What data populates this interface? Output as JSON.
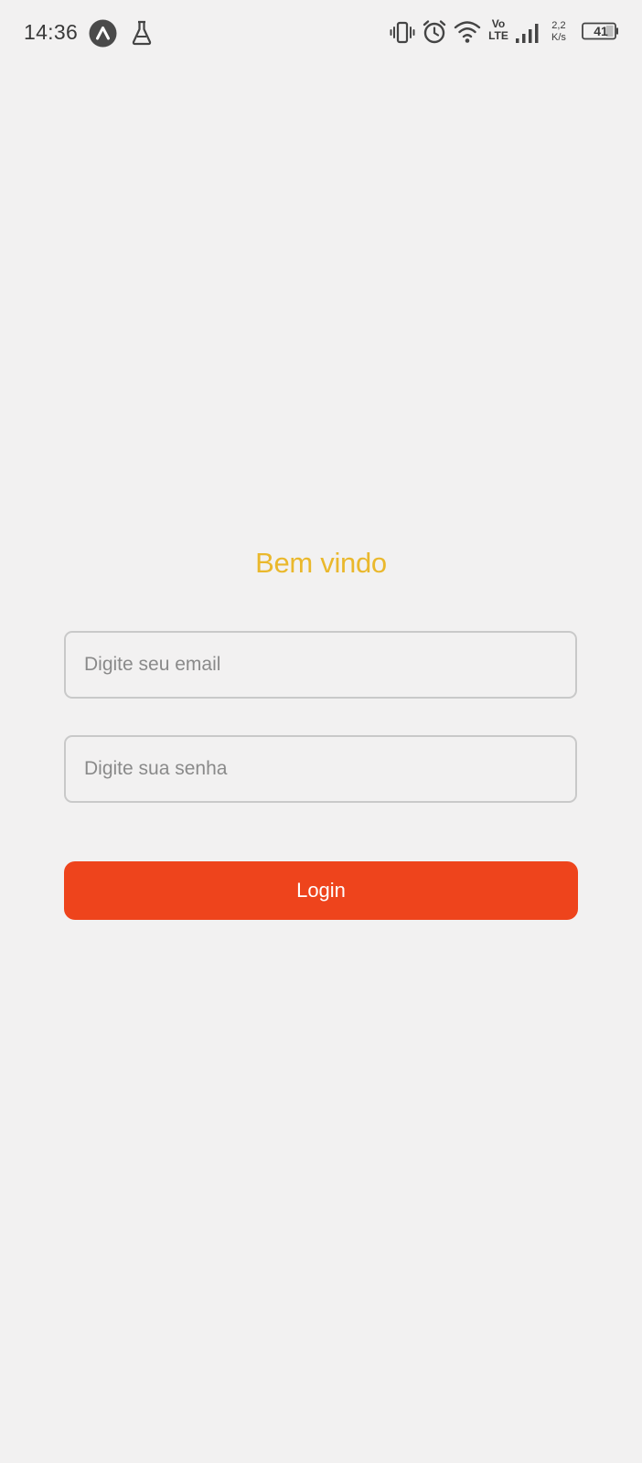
{
  "status_bar": {
    "time": "14:36",
    "speed_value": "2,2",
    "speed_unit": "K/s",
    "volte_top": "Vo",
    "volte_bottom": "LTE",
    "battery_level": "41"
  },
  "login": {
    "title": "Bem vindo",
    "email_placeholder": "Digite seu email",
    "password_placeholder": "Digite sua senha",
    "button_label": "Login"
  },
  "colors": {
    "background": "#f2f1f1",
    "title": "#eab82c",
    "button": "#ee441c",
    "field_border": "#c9c9c9"
  }
}
